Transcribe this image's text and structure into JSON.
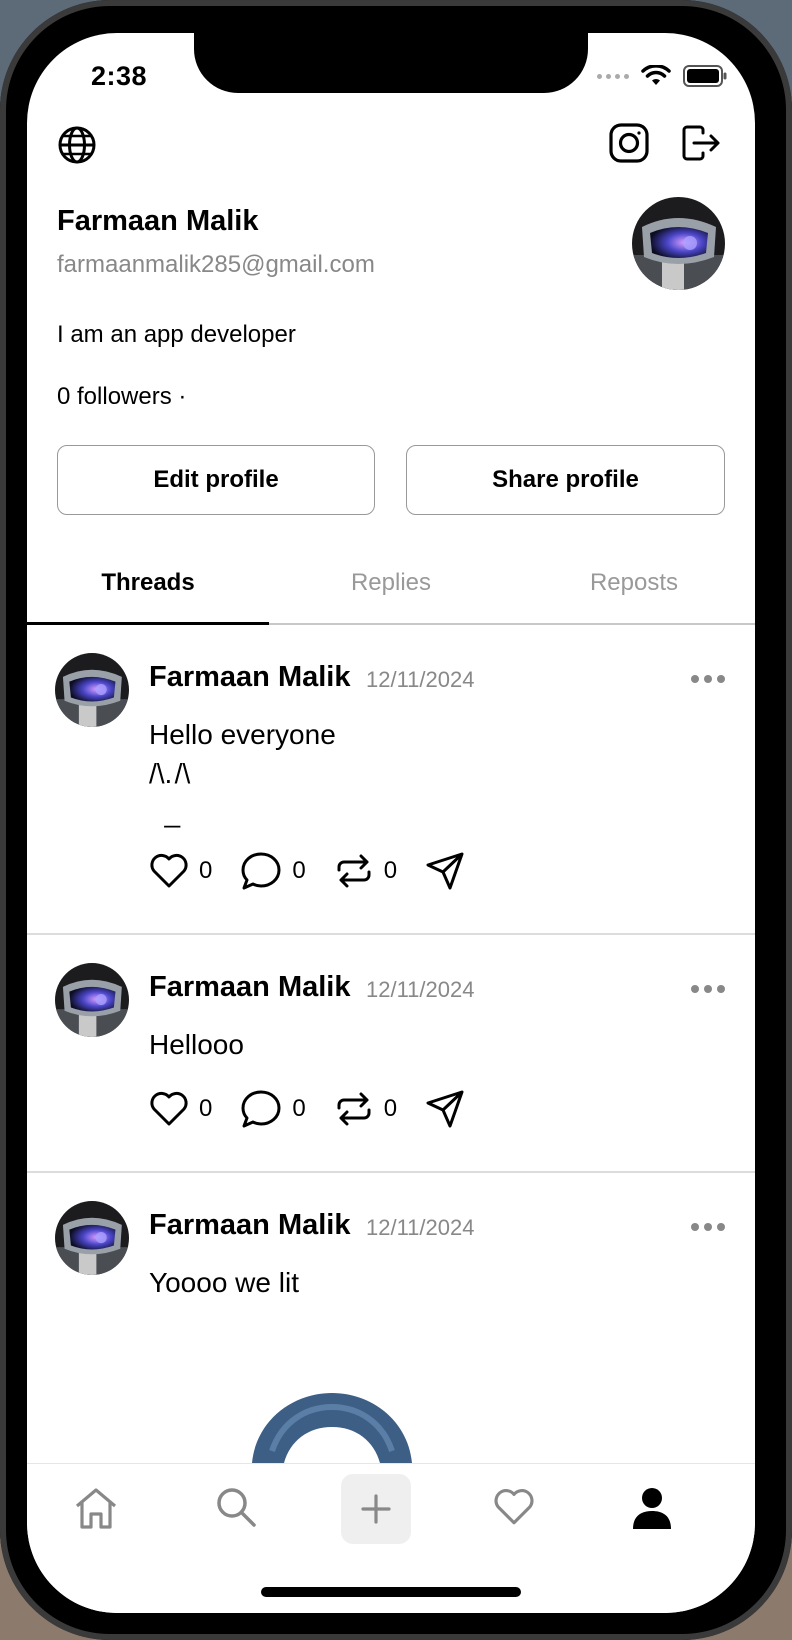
{
  "status_bar": {
    "time": "2:38"
  },
  "profile": {
    "name": "Farmaan Malik",
    "email": "farmaanmalik285@gmail.com",
    "bio": "I am an app developer",
    "followers": "0 followers ·",
    "edit_button": "Edit profile",
    "share_button": "Share profile"
  },
  "tabs": [
    {
      "label": "Threads",
      "active": true
    },
    {
      "label": "Replies",
      "active": false
    },
    {
      "label": "Reposts",
      "active": false
    }
  ],
  "posts": [
    {
      "author": "Farmaan Malik",
      "date": "12/11/2024",
      "text": "Hello everyone\n/\\. /\\\n  _",
      "likes": "0",
      "comments": "0",
      "reposts": "0"
    },
    {
      "author": "Farmaan Malik",
      "date": "12/11/2024",
      "text": "Hellooo",
      "likes": "0",
      "comments": "0",
      "reposts": "0"
    },
    {
      "author": "Farmaan Malik",
      "date": "12/11/2024",
      "text": "Yoooo we lit"
    }
  ],
  "icons": {
    "top_left": "globe-icon",
    "top_right": [
      "instagram-icon",
      "logout-icon"
    ],
    "tabbar": [
      "home-icon",
      "search-icon",
      "plus-icon",
      "heart-icon",
      "profile-icon"
    ]
  },
  "colors": {
    "accent": "#000000",
    "muted": "#888888",
    "border": "#999999"
  }
}
